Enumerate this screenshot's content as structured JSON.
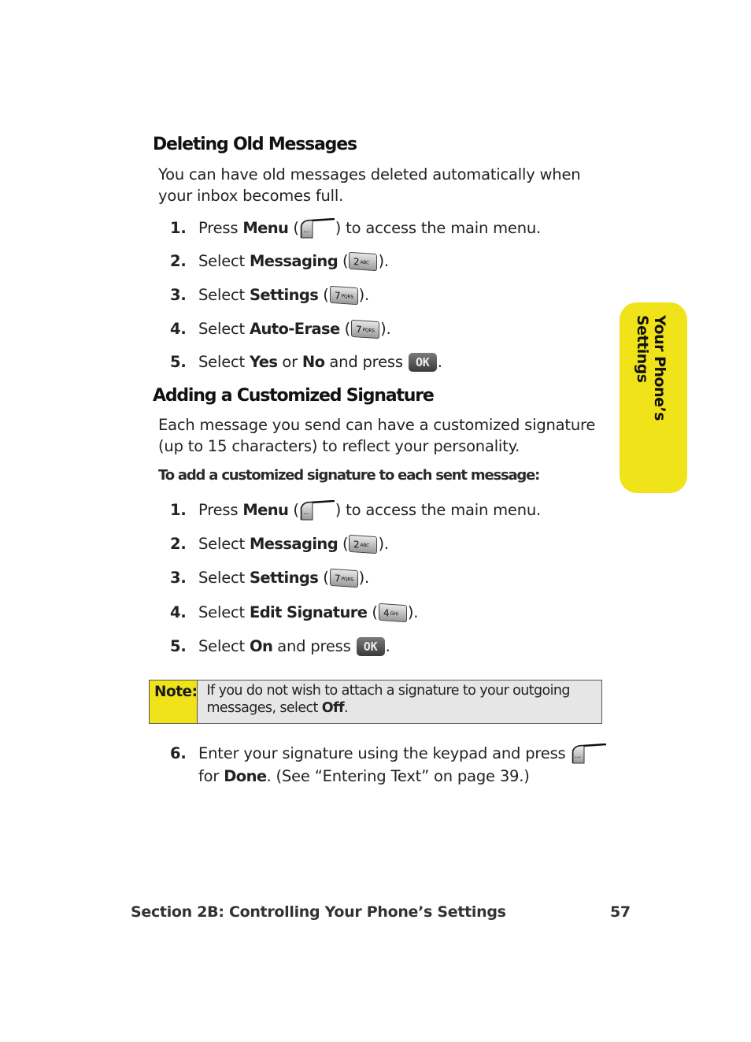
{
  "section1": {
    "heading": "Deleting Old Messages",
    "intro": "You can have old messages deleted automatically when your inbox becomes full.",
    "steps": [
      {
        "num": "1.",
        "pre": "Press ",
        "bold": "Menu",
        "mid": " (",
        "key": "menu-softkey",
        "post": ") to access the main menu."
      },
      {
        "num": "2.",
        "pre": "Select ",
        "bold": "Messaging",
        "mid": " (",
        "key_digit": "2",
        "key_letters": "ABC",
        "post": ")."
      },
      {
        "num": "3.",
        "pre": "Select ",
        "bold": "Settings",
        "mid": " (",
        "key_digit": "7",
        "key_letters": "PQRS",
        "post": ")."
      },
      {
        "num": "4.",
        "pre": "Select ",
        "bold": "Auto-Erase",
        "mid": " (",
        "key_digit": "7",
        "key_letters": "PQRS",
        "post": ")."
      },
      {
        "num": "5.",
        "pre": "Select ",
        "bold": "Yes",
        "mid2": " or ",
        "bold2": "No",
        "mid": " and press ",
        "key_ok": "OK",
        "post": "."
      }
    ]
  },
  "section2": {
    "heading": "Adding a Customized Signature",
    "intro": "Each message you send can have a customized signature (up to 15 characters) to reflect your personality.",
    "subheading": "To add a customized signature to each sent message:",
    "steps": [
      {
        "num": "1.",
        "pre": "Press ",
        "bold": "Menu",
        "mid": " (",
        "post": ") to access the main menu."
      },
      {
        "num": "2.",
        "pre": "Select ",
        "bold": "Messaging",
        "mid": " (",
        "key_digit": "2",
        "key_letters": "ABC",
        "post": ")."
      },
      {
        "num": "3.",
        "pre": "Select ",
        "bold": "Settings",
        "mid": " (",
        "key_digit": "7",
        "key_letters": "PQRS",
        "post": ")."
      },
      {
        "num": "4.",
        "pre": "Select ",
        "bold": "Edit Signature",
        "mid": " (",
        "key_digit": "4",
        "key_letters": "GHI",
        "post": ")."
      },
      {
        "num": "5.",
        "pre": "Select ",
        "bold": "On",
        "mid": " and press ",
        "key_ok": "OK",
        "post": "."
      }
    ],
    "note": {
      "label": "Note:",
      "text_pre": "If you do not wish to attach a signature to your outgoing messages, select ",
      "text_bold": "Off",
      "text_post": "."
    },
    "step6": {
      "num": "6.",
      "line1": "Enter your signature using the keypad and press",
      "line2_pre": "for ",
      "line2_bold": "Done",
      "line2_post": ". (See “Entering Text” on page 39.)"
    }
  },
  "side_tab": {
    "label": "Your Phone’s Settings",
    "color": "#f0e31a"
  },
  "footer": {
    "section": "Section 2B: Controlling Your Phone’s Settings",
    "page": "57"
  }
}
